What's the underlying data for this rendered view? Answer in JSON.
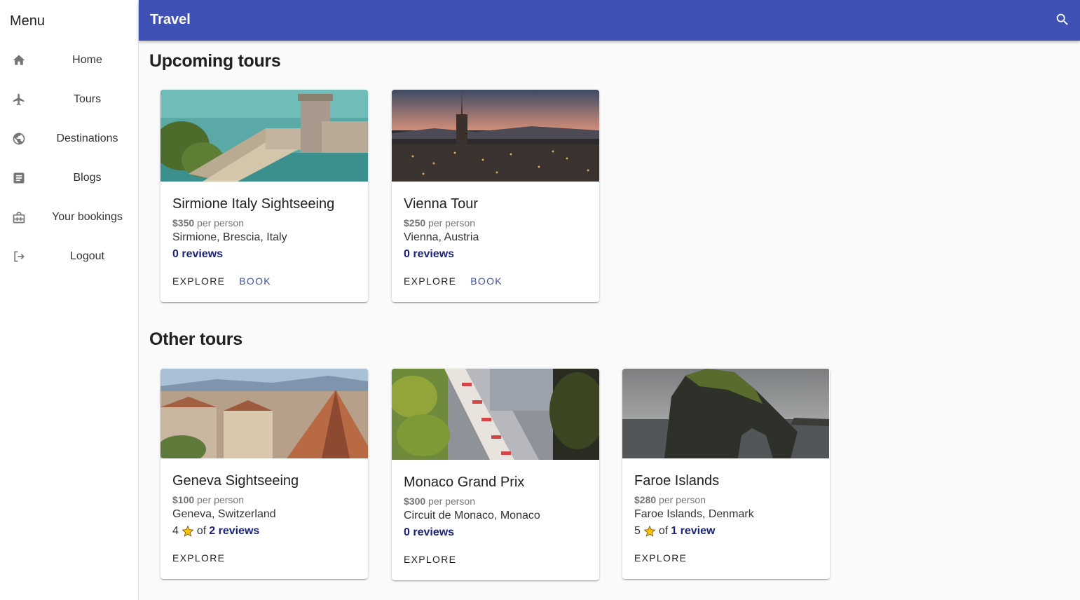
{
  "sidebar": {
    "title": "Menu",
    "items": [
      {
        "label": "Home",
        "icon": "home-icon"
      },
      {
        "label": "Tours",
        "icon": "airplane-icon"
      },
      {
        "label": "Destinations",
        "icon": "globe-icon"
      },
      {
        "label": "Blogs",
        "icon": "article-icon"
      },
      {
        "label": "Your bookings",
        "icon": "briefcase-icon"
      },
      {
        "label": "Logout",
        "icon": "logout-icon"
      }
    ]
  },
  "appbar": {
    "title": "Travel",
    "search_icon": "search-icon",
    "color": "#3f51b5"
  },
  "upcoming": {
    "title": "Upcoming tours",
    "cards": [
      {
        "name": "Sirmione Italy Sightseeing",
        "price": "$350",
        "price_suffix": "per person",
        "location": "Sirmione, Brescia, Italy",
        "reviews": "0 reviews",
        "explore": "Explore",
        "book": "Book"
      },
      {
        "name": "Vienna Tour",
        "price": "$250",
        "price_suffix": "per person",
        "location": "Vienna, Austria",
        "reviews": "0 reviews",
        "explore": "Explore",
        "book": "Book"
      }
    ]
  },
  "other": {
    "title": "Other tours",
    "cards": [
      {
        "name": "Geneva Sightseeing",
        "price": "$100",
        "price_suffix": "per person",
        "location": "Geneva, Switzerland",
        "rating": "4",
        "of": "of",
        "reviews": "2 reviews",
        "explore": "Explore"
      },
      {
        "name": "Monaco Grand Prix",
        "price": "$300",
        "price_suffix": "per person",
        "location": "Circuit de Monaco, Monaco",
        "reviews": "0 reviews",
        "explore": "Explore"
      },
      {
        "name": "Faroe Islands",
        "price": "$280",
        "price_suffix": "per person",
        "location": "Faroe Islands, Denmark",
        "rating": "5",
        "of": "of",
        "reviews": "1 review",
        "explore": "Explore"
      }
    ]
  }
}
